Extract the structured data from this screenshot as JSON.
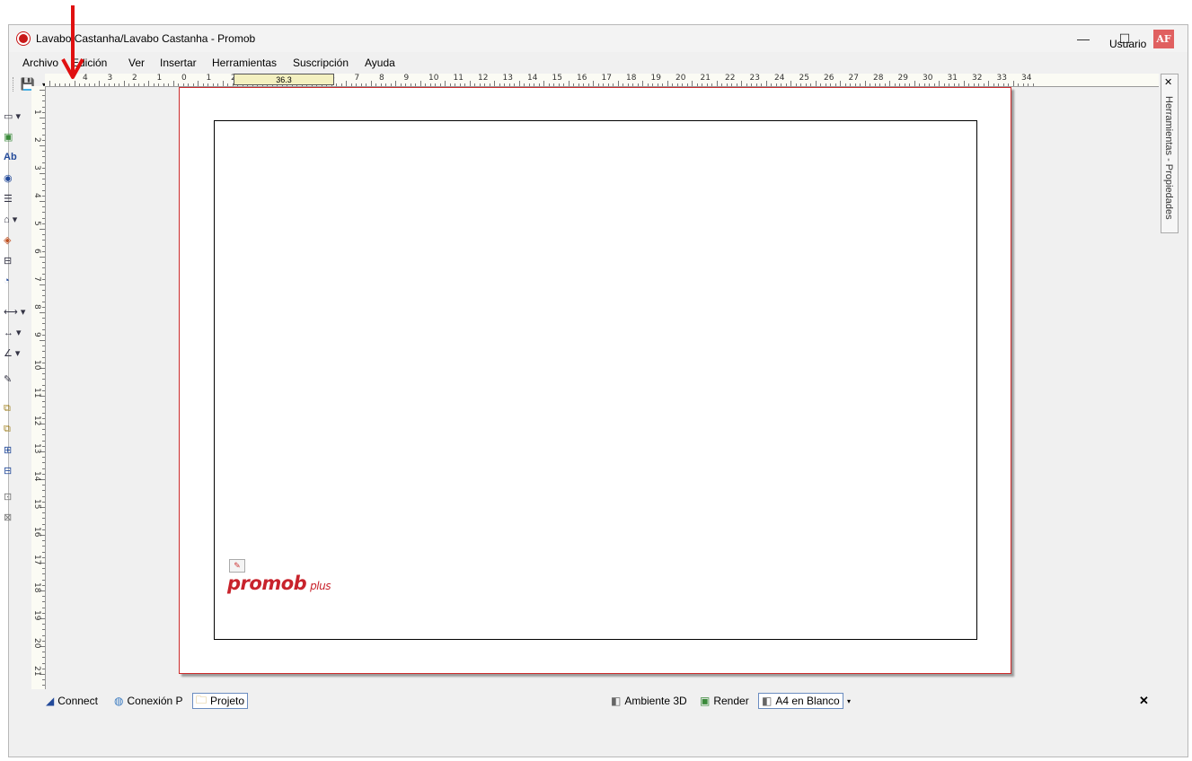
{
  "window": {
    "title": "Lavabo Castanha/Lavabo Castanha - Promob",
    "controls": {
      "minimize": "—",
      "maximize": "☐",
      "close": "✕"
    }
  },
  "menu": [
    "Archivo",
    "Edición",
    "Ver",
    "Insertar",
    "Herramientas",
    "Suscripción",
    "Ayuda"
  ],
  "user": {
    "label": "Usuario",
    "initials": "AF"
  },
  "ruler": {
    "marker": "36.3",
    "h_ticks": [
      "4",
      "3",
      "2",
      "1",
      "0",
      "1",
      "2",
      "3",
      "4",
      "5",
      "6",
      "7",
      "8",
      "9",
      "10",
      "11",
      "12",
      "13",
      "14",
      "15",
      "16",
      "17",
      "18",
      "19",
      "20",
      "21",
      "22",
      "23",
      "24",
      "25",
      "26",
      "27",
      "28",
      "29",
      "30",
      "31",
      "32",
      "33",
      "34"
    ],
    "v_ticks": [
      "1",
      "2",
      "3",
      "4",
      "5",
      "6",
      "7",
      "8",
      "9",
      "10",
      "11",
      "12",
      "13",
      "14",
      "15",
      "16",
      "17",
      "18",
      "19",
      "20",
      "21"
    ]
  },
  "side_panel": {
    "label": "Herramientas - Propiedades"
  },
  "logo": {
    "text": "promob",
    "suffix": "plus"
  },
  "bottom_tabs": {
    "connect": "Connect",
    "conexion": "Conexión P",
    "projeto": "Projeto",
    "ambiente": "Ambiente 3D",
    "render": "Render",
    "a4": "A4 en Blanco"
  },
  "colors": {
    "accent_red": "#c8232c",
    "page_border": "#cc2b2b",
    "annotation_arrow": "#e01010"
  }
}
